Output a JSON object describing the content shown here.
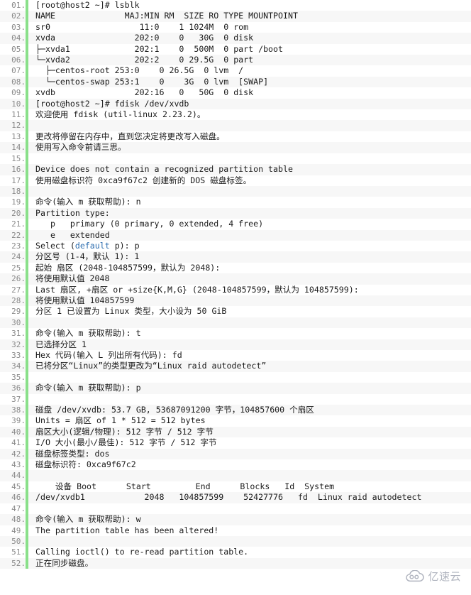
{
  "code_block": {
    "language": "shell-session",
    "gutter_accent_color": "#8ae08a",
    "line_number_color": "#8a8a8a",
    "text_color": "#1a1a1a",
    "keyword_color": "#2f6fb0",
    "stripe_color": "#f7f7f7",
    "line_number_suffix": ".",
    "lines": [
      {
        "n": "01.",
        "text": "[root@host2 ~]# lsblk"
      },
      {
        "n": "02.",
        "text": "NAME              MAJ:MIN RM  SIZE RO TYPE MOUNTPOINT"
      },
      {
        "n": "03.",
        "text": "sr0                  11:0    1 1024M  0 rom"
      },
      {
        "n": "04.",
        "text": "xvda                202:0    0   30G  0 disk"
      },
      {
        "n": "05.",
        "text": "├─xvda1             202:1    0  500M  0 part /boot"
      },
      {
        "n": "06.",
        "text": "└─xvda2             202:2    0 29.5G  0 part"
      },
      {
        "n": "07.",
        "text": "  ├─centos-root 253:0    0 26.5G  0 lvm  /"
      },
      {
        "n": "08.",
        "text": "  └─centos-swap 253:1    0    3G  0 lvm  [SWAP]"
      },
      {
        "n": "09.",
        "text": "xvdb                202:16   0   50G  0 disk"
      },
      {
        "n": "10.",
        "text": "[root@host2 ~]# fdisk /dev/xvdb"
      },
      {
        "n": "11.",
        "text": "欢迎使用 fdisk (util-linux 2.23.2)。"
      },
      {
        "n": "12.",
        "text": ""
      },
      {
        "n": "13.",
        "text": "更改将停留在内存中，直到您决定将更改写入磁盘。"
      },
      {
        "n": "14.",
        "text": "使用写入命令前请三思。"
      },
      {
        "n": "15.",
        "text": ""
      },
      {
        "n": "16.",
        "text": "Device does not contain a recognized partition table"
      },
      {
        "n": "17.",
        "text": "使用磁盘标识符 0xca9f67c2 创建新的 DOS 磁盘标签。"
      },
      {
        "n": "18.",
        "text": ""
      },
      {
        "n": "19.",
        "text": "命令(输入 m 获取帮助): n"
      },
      {
        "n": "20.",
        "text": "Partition type:"
      },
      {
        "n": "21.",
        "text": "   p   primary (0 primary, 0 extended, 4 free)"
      },
      {
        "n": "22.",
        "text": "   e   extended"
      },
      {
        "n": "23.",
        "segments": [
          {
            "t": "Select ("
          },
          {
            "t": "default",
            "cls": "tok-kw"
          },
          {
            "t": " p): p"
          }
        ],
        "text": "Select (default p): p"
      },
      {
        "n": "24.",
        "text": "分区号 (1-4，默认 1): 1"
      },
      {
        "n": "25.",
        "text": "起始 扇区 (2048-104857599，默认为 2048):"
      },
      {
        "n": "26.",
        "text": "将使用默认值 2048"
      },
      {
        "n": "27.",
        "text": "Last 扇区, +扇区 or +size{K,M,G} (2048-104857599，默认为 104857599):"
      },
      {
        "n": "28.",
        "text": "将使用默认值 104857599"
      },
      {
        "n": "29.",
        "text": "分区 1 已设置为 Linux 类型，大小设为 50 GiB"
      },
      {
        "n": "30.",
        "text": ""
      },
      {
        "n": "31.",
        "text": "命令(输入 m 获取帮助): t"
      },
      {
        "n": "32.",
        "text": "已选择分区 1"
      },
      {
        "n": "33.",
        "text": "Hex 代码(输入 L 列出所有代码): fd"
      },
      {
        "n": "34.",
        "text": "已将分区“Linux”的类型更改为“Linux raid autodetect”"
      },
      {
        "n": "35.",
        "text": ""
      },
      {
        "n": "36.",
        "text": "命令(输入 m 获取帮助): p"
      },
      {
        "n": "37.",
        "text": ""
      },
      {
        "n": "38.",
        "text": "磁盘 /dev/xvdb: 53.7 GB, 53687091200 字节，104857600 个扇区"
      },
      {
        "n": "39.",
        "text": "Units = 扇区 of 1 * 512 = 512 bytes"
      },
      {
        "n": "40.",
        "text": "扇区大小(逻辑/物理): 512 字节 / 512 字节"
      },
      {
        "n": "41.",
        "text": "I/O 大小(最小/最佳): 512 字节 / 512 字节"
      },
      {
        "n": "42.",
        "text": "磁盘标签类型: dos"
      },
      {
        "n": "43.",
        "text": "磁盘标识符: 0xca9f67c2"
      },
      {
        "n": "44.",
        "text": ""
      },
      {
        "n": "45.",
        "text": "    设备 Boot      Start         End      Blocks   Id  System"
      },
      {
        "n": "46.",
        "text": "/dev/xvdb1            2048   104857599    52427776   fd  Linux raid autodetect"
      },
      {
        "n": "47.",
        "text": ""
      },
      {
        "n": "48.",
        "text": "命令(输入 m 获取帮助): w"
      },
      {
        "n": "49.",
        "text": "The partition table has been altered!"
      },
      {
        "n": "50.",
        "text": ""
      },
      {
        "n": "51.",
        "text": "Calling ioctl() to re-read partition table."
      },
      {
        "n": "52.",
        "text": "正在同步磁盘。"
      }
    ]
  },
  "watermark": {
    "icon": "cloud-icon",
    "text": "亿速云",
    "color": "#a3a8b4"
  }
}
